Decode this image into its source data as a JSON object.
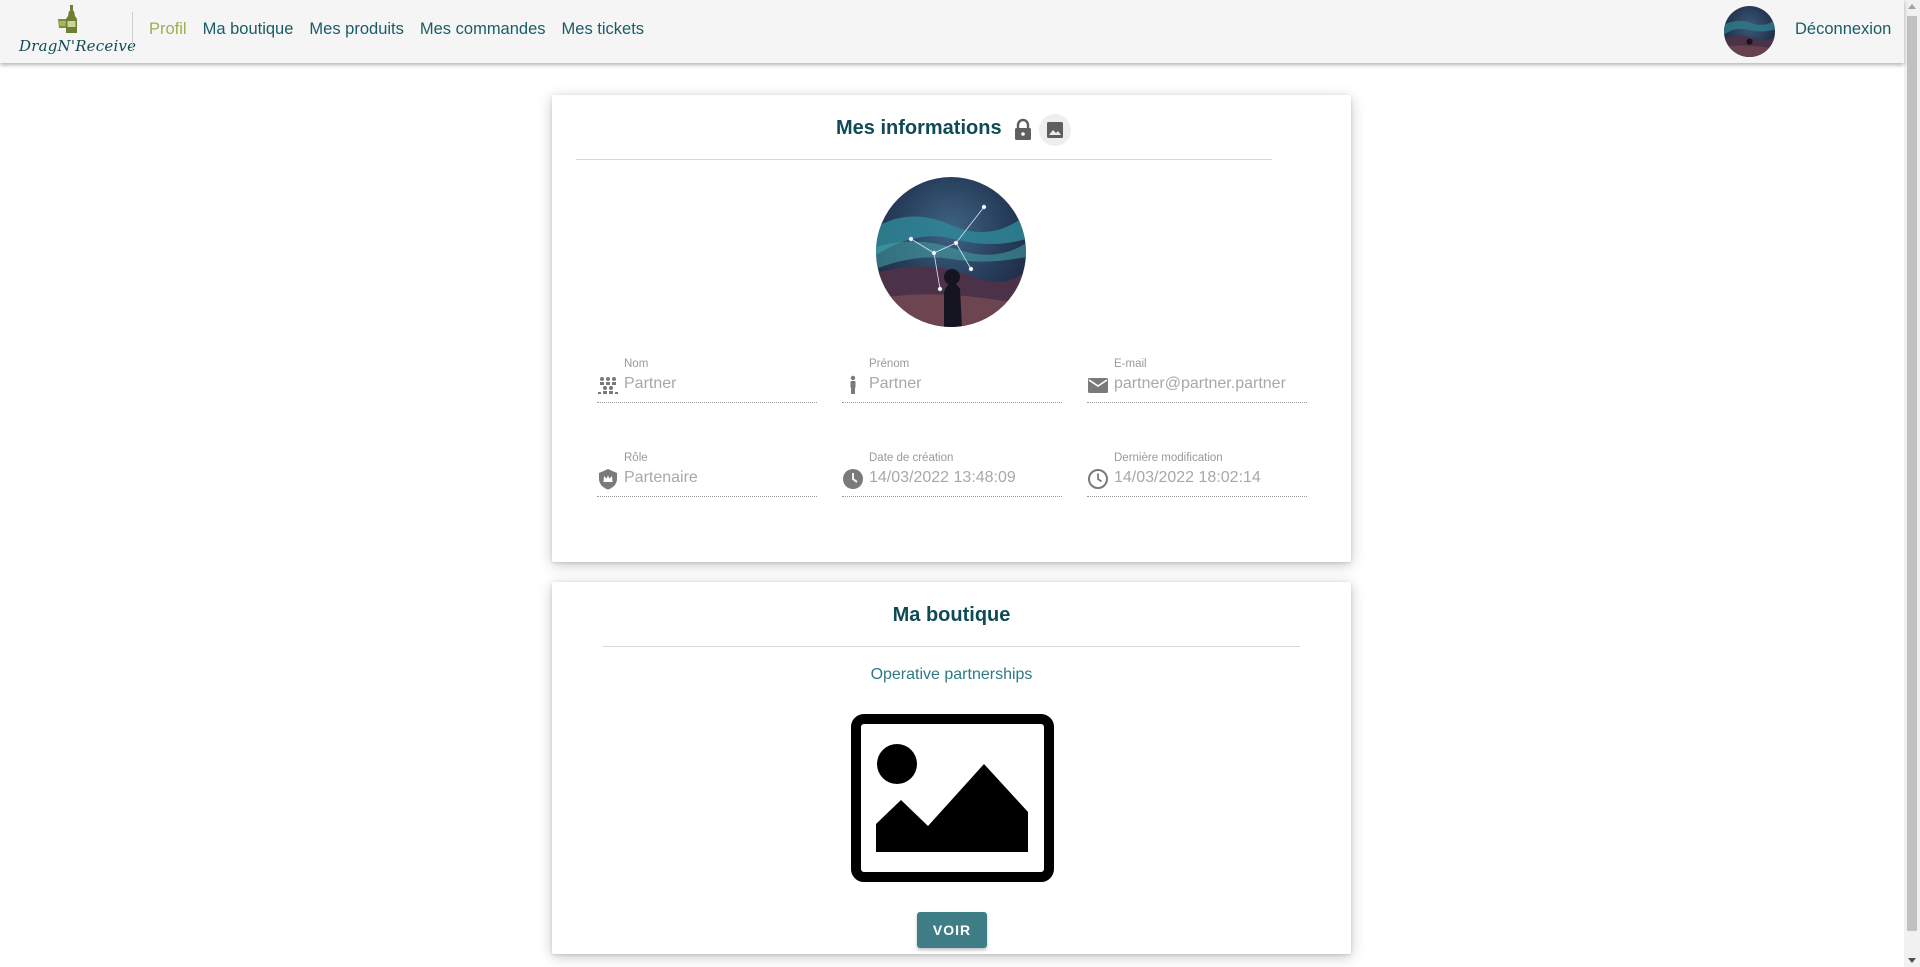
{
  "app": {
    "logo_text": "DragN'Receive"
  },
  "nav": {
    "items": [
      {
        "label": "Profil",
        "active": true
      },
      {
        "label": "Ma boutique",
        "active": false
      },
      {
        "label": "Mes produits",
        "active": false
      },
      {
        "label": "Mes commandes",
        "active": false
      },
      {
        "label": "Mes tickets",
        "active": false
      }
    ],
    "logout_label": "Déconnexion",
    "avatar_icon": "user-avatar-galaxy"
  },
  "info_card": {
    "title": "Mes informations",
    "lock_icon": "lock-icon",
    "image_icon": "image-icon",
    "fields": {
      "nom": {
        "label": "Nom",
        "value": "Partner",
        "icon": "people-icon"
      },
      "prenom": {
        "label": "Prénom",
        "value": "Partner",
        "icon": "person-icon"
      },
      "email": {
        "label": "E-mail",
        "value": "partner@partner.partner",
        "icon": "mail-icon"
      },
      "role": {
        "label": "Rôle",
        "value": "Partenaire",
        "icon": "crown-shield-icon"
      },
      "created": {
        "label": "Date de création",
        "value": "14/03/2022 13:48:09",
        "icon": "clock-filled-icon"
      },
      "modified": {
        "label": "Dernière modification",
        "value": "14/03/2022 18:02:14",
        "icon": "clock-outline-icon"
      }
    }
  },
  "shop_card": {
    "title": "Ma boutique",
    "shop_name": "Operative partnerships",
    "image_icon": "image-placeholder-icon",
    "button_label": "VOIR"
  },
  "colors": {
    "primary": "#0f4a55",
    "link": "#1a5c66",
    "active": "#9ab14e",
    "button": "#3f7e86"
  }
}
